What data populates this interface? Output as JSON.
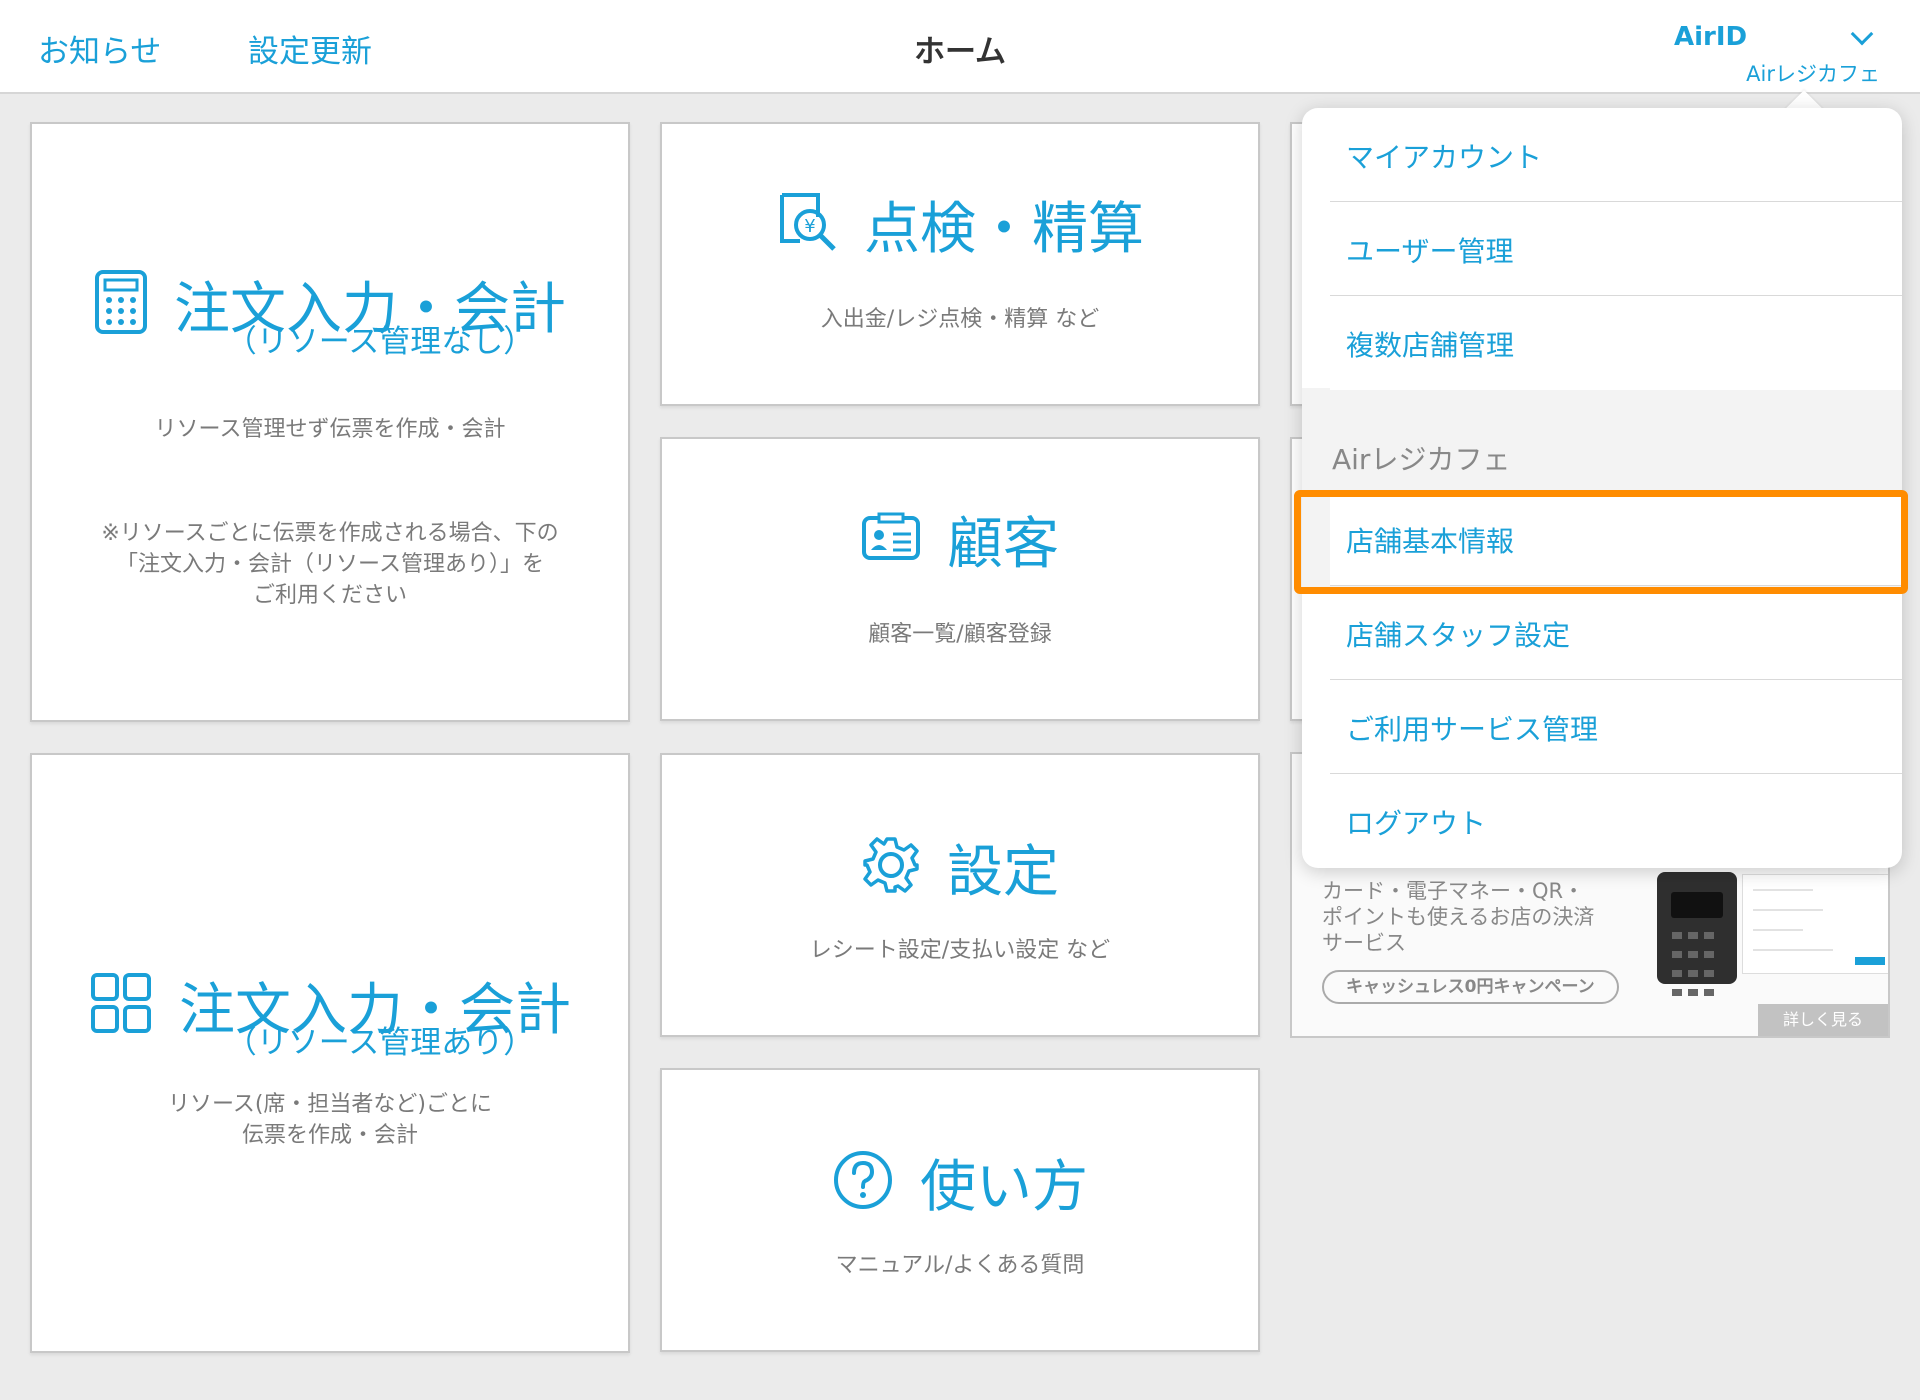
{
  "header": {
    "notice_label": "お知らせ",
    "settings_update_label": "設定更新",
    "title": "ホーム",
    "account": {
      "airid_label": "AirID",
      "store_name": "Airレジカフェ"
    }
  },
  "tiles": {
    "order_no_resource": {
      "title": "注文入力・会計",
      "subtitle": "（リソース管理なし）",
      "description": "リソース管理せず伝票を作成・会計",
      "note_line1": "※リソースごとに伝票を作成される場合、下の",
      "note_line2": "「注文入力・会計（リソース管理あり）」を",
      "note_line3": "ご利用ください"
    },
    "inspection": {
      "title": "点検・精算",
      "description": "入出金/レジ点検・精算 など"
    },
    "customer": {
      "title": "顧客",
      "description": "顧客一覧/顧客登録"
    },
    "order_with_resource": {
      "title": "注文入力・会計",
      "subtitle": "（リソース管理あり）",
      "description_line1": "リソース(席・担当者など)ごとに",
      "description_line2": "伝票を作成・会計"
    },
    "settings": {
      "title": "設定",
      "description": "レシート設定/支払い設定 など"
    },
    "howto": {
      "title": "使い方",
      "description": "マニュアル/よくある質問"
    }
  },
  "ad": {
    "text_line1": "カード・電子マネー・QR・",
    "text_line2": "ポイントも使えるお店の決済",
    "text_line3": "サービス",
    "campaign_label": "キャッシュレス0円キャンペーン",
    "more_label": "詳しく見る"
  },
  "menu": {
    "account_items": [
      {
        "label": "マイアカウント"
      },
      {
        "label": "ユーザー管理"
      },
      {
        "label": "複数店舗管理"
      }
    ],
    "store_section_title": "Airレジカフェ",
    "store_items": [
      {
        "label": "店舗基本情報",
        "highlighted": true
      },
      {
        "label": "店舗スタッフ設定"
      },
      {
        "label": "ご利用サービス管理"
      },
      {
        "label": "ログアウト"
      }
    ]
  },
  "colors": {
    "accent": "#1aa0d8",
    "highlight": "#ff8c00"
  }
}
